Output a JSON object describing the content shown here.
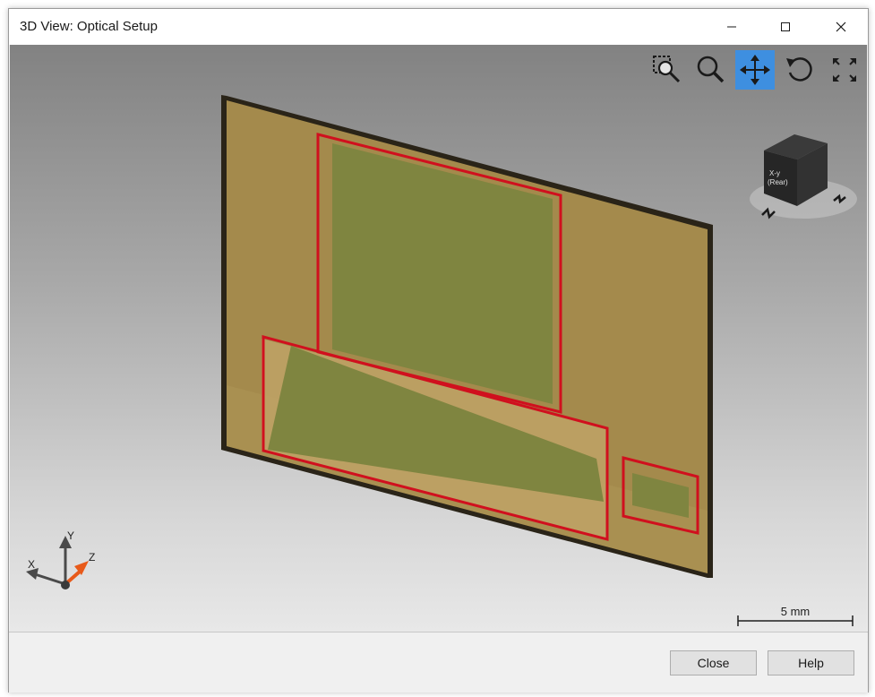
{
  "window": {
    "title": "3D View: Optical Setup"
  },
  "titlebar_controls": {
    "minimize_icon": "minimize-icon",
    "maximize_icon": "maximize-icon",
    "close_icon": "close-icon"
  },
  "toolbar": {
    "tools": [
      {
        "name": "zoom-region",
        "icon": "zoom-region-icon",
        "active": false
      },
      {
        "name": "zoom",
        "icon": "magnifier-icon",
        "active": false
      },
      {
        "name": "pan",
        "icon": "move-arrows-icon",
        "active": true
      },
      {
        "name": "rotate",
        "icon": "rotate-icon",
        "active": false
      },
      {
        "name": "fit-all",
        "icon": "expand-arrows-icon",
        "active": false
      }
    ]
  },
  "view_cube": {
    "front_face_label_line1": "X-y",
    "front_face_label_line2": "(Rear)"
  },
  "axes": {
    "x": "X",
    "y": "Y",
    "z": "Z"
  },
  "scale": {
    "label": "5 mm"
  },
  "buttons": {
    "close": "Close",
    "help": "Help"
  },
  "colors": {
    "accent": "#3e8fe0",
    "plate": "#a48a4c",
    "plate_light": "#c0a468",
    "region_fill": "#7f8540",
    "selection_outline": "#d0101e",
    "plate_edge": "#2a2418",
    "z_axis": "#e85a1a"
  }
}
